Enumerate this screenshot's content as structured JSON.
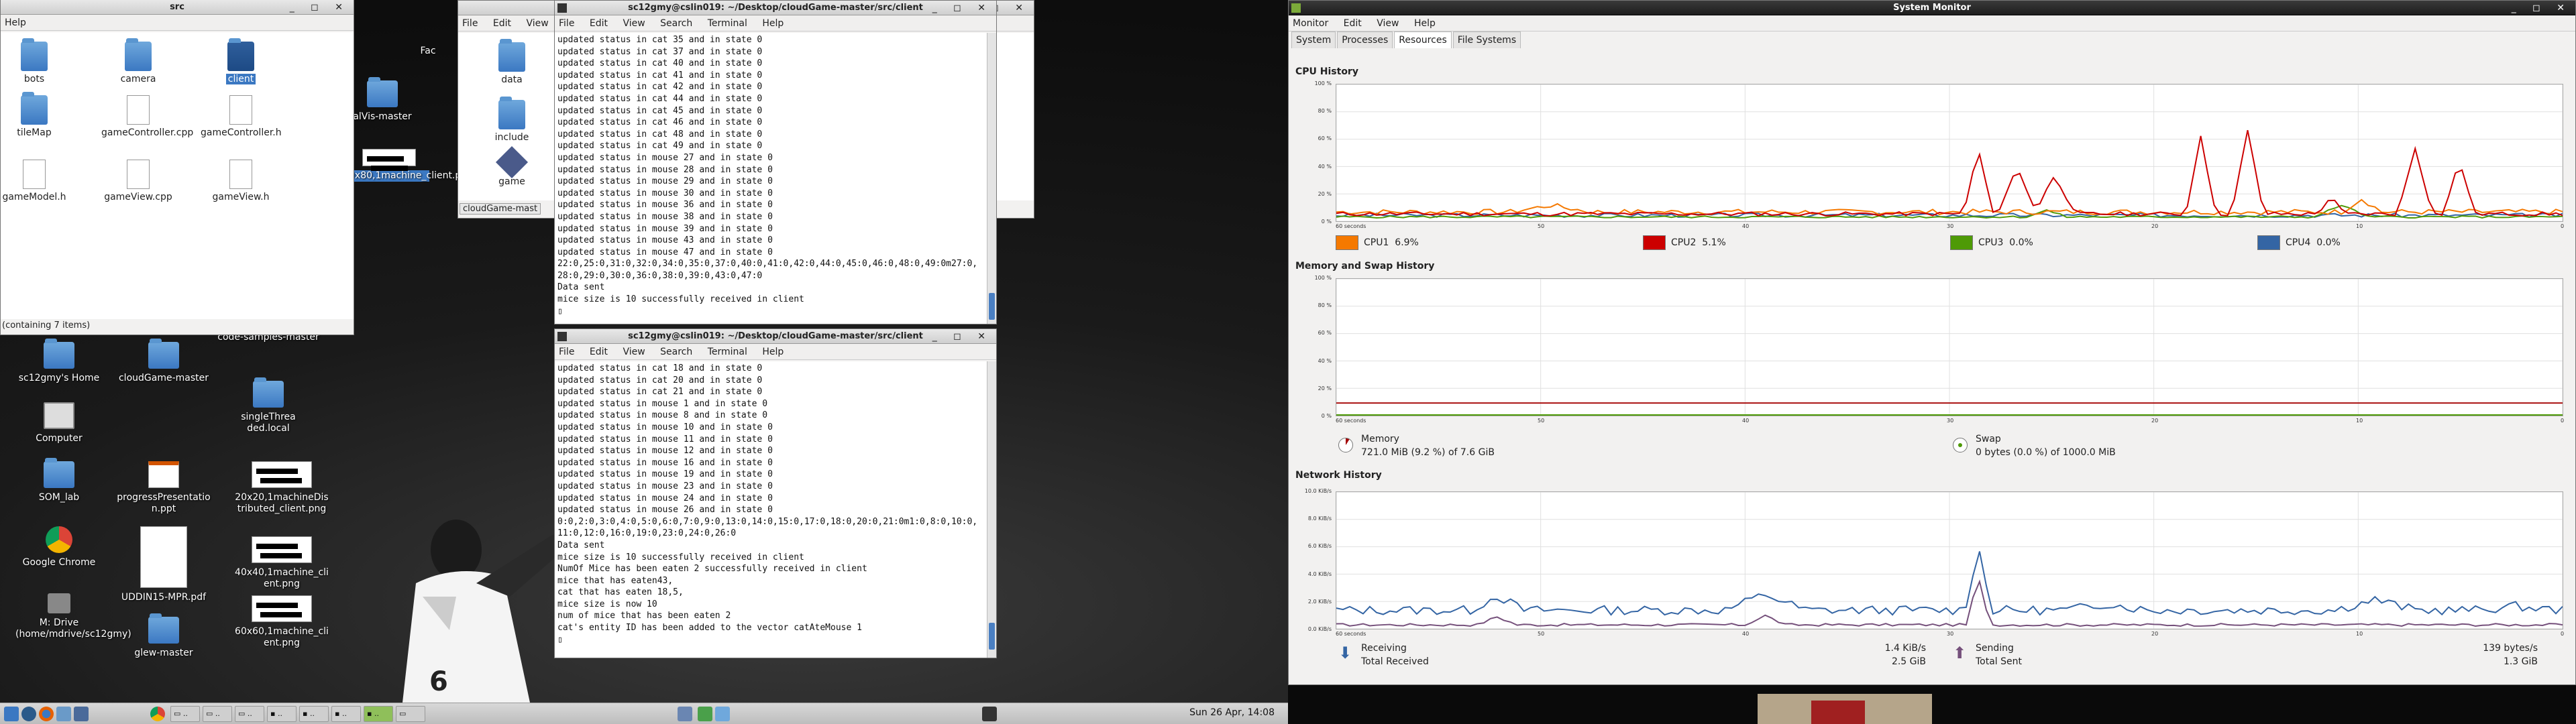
{
  "desktop_icons": [
    {
      "label": "sc12gmy's Home",
      "icon": "home-folder-icon"
    },
    {
      "label": "cloudGame-master",
      "icon": "folder-icon"
    },
    {
      "label": "code-samples-master",
      "icon": "folder-icon"
    },
    {
      "label": "Computer",
      "icon": "computer-icon"
    },
    {
      "label": "singleThreaded.local",
      "icon": "folder-icon"
    },
    {
      "label": "SOM_lab",
      "icon": "folder-icon"
    },
    {
      "label": "progressPresentation.ppt",
      "icon": "presentation-icon"
    },
    {
      "label": "20x20,1machineDistributed_client.png",
      "icon": "image-icon"
    },
    {
      "label": "Google Chrome",
      "icon": "chrome-icon"
    },
    {
      "label": "UDDIN15-MPR.pdf",
      "icon": "pdf-icon"
    },
    {
      "label": "40x40,1machine_client.png",
      "icon": "image-icon"
    },
    {
      "label": "M: Drive (home/mdrive/sc12gmy)",
      "icon": "drive-icon"
    },
    {
      "label": "60x60,1machine_client.png",
      "icon": "image-icon"
    },
    {
      "label": "glew-master",
      "icon": "folder-icon"
    },
    {
      "label": "alVis-master",
      "icon": "folder-icon"
    },
    {
      "label": "0x80,1machine_client.png",
      "icon": "image-icon"
    },
    {
      "label": "Fac",
      "icon": "folder-icon"
    }
  ],
  "file_manager": {
    "title": "src",
    "menu": "Help",
    "status": "(containing 7 items)",
    "items": [
      "bots",
      "camera",
      "client",
      "tileMap",
      "gameController.cpp",
      "gameController.h",
      "gameModel.h",
      "gameView.cpp",
      "gameView.h"
    ]
  },
  "file_manager2": {
    "menu": [
      "File",
      "Edit",
      "View"
    ],
    "items": [
      "data",
      "include",
      "game"
    ],
    "path": "cloudGame-mast"
  },
  "terminal1": {
    "title": "sc12gmy@cslin019: ~/Desktop/cloudGame-master/src/client",
    "menu": [
      "File",
      "Edit",
      "View",
      "Search",
      "Terminal",
      "Help"
    ],
    "lines": [
      "updated status in cat 35 and in state 0",
      "updated status in cat 37 and in state 0",
      "updated status in cat 40 and in state 0",
      "updated status in cat 41 and in state 0",
      "updated status in cat 42 and in state 0",
      "updated status in cat 44 and in state 0",
      "updated status in cat 45 and in state 0",
      "updated status in cat 46 and in state 0",
      "updated status in cat 48 and in state 0",
      "updated status in cat 49 and in state 0",
      "updated status in mouse 27 and in state 0",
      "updated status in mouse 28 and in state 0",
      "updated status in mouse 29 and in state 0",
      "updated status in mouse 30 and in state 0",
      "updated status in mouse 36 and in state 0",
      "updated status in mouse 38 and in state 0",
      "updated status in mouse 39 and in state 0",
      "updated status in mouse 43 and in state 0",
      "updated status in mouse 47 and in state 0",
      "22:0,25:0,31:0,32:0,34:0,35:0,37:0,40:0,41:0,42:0,44:0,45:0,46:0,48:0,49:0m27:0,",
      "28:0,29:0,30:0,36:0,38:0,39:0,43:0,47:0",
      "Data sent",
      "mice size is 10 successfully received in client",
      "▯"
    ]
  },
  "terminal2": {
    "title": "sc12gmy@cslin019: ~/Desktop/cloudGame-master/src/client",
    "menu": [
      "File",
      "Edit",
      "View",
      "Search",
      "Terminal",
      "Help"
    ],
    "lines": [
      "updated status in cat 18 and in state 0",
      "updated status in cat 20 and in state 0",
      "updated status in cat 21 and in state 0",
      "updated status in mouse 1 and in state 0",
      "updated status in mouse 8 and in state 0",
      "updated status in mouse 10 and in state 0",
      "updated status in mouse 11 and in state 0",
      "updated status in mouse 12 and in state 0",
      "updated status in mouse 16 and in state 0",
      "updated status in mouse 19 and in state 0",
      "updated status in mouse 23 and in state 0",
      "updated status in mouse 24 and in state 0",
      "updated status in mouse 26 and in state 0",
      "0:0,2:0,3:0,4:0,5:0,6:0,7:0,9:0,13:0,14:0,15:0,17:0,18:0,20:0,21:0m1:0,8:0,10:0,",
      "11:0,12:0,16:0,19:0,23:0,24:0,26:0",
      "Data sent",
      "mice size is 10 successfully received in client",
      "NumOf Mice has been eaten 2 successfully received in client",
      "mice that has eaten43,",
      "cat that has eaten 18,5,",
      "mice size is now 10",
      "num of mice that has been eaten 2",
      "cat's entity ID has been added to the vector catAteMouse 1",
      "▯"
    ]
  },
  "system_monitor": {
    "title": "System Monitor",
    "menu": [
      "Monitor",
      "Edit",
      "View",
      "Help"
    ],
    "tabs": [
      "System",
      "Processes",
      "Resources",
      "File Systems"
    ],
    "cpu_title": "CPU History",
    "mem_title": "Memory and Swap History",
    "net_title": "Network History",
    "x_labels": [
      "60 seconds",
      "50",
      "40",
      "30",
      "20",
      "10",
      "0"
    ],
    "cpu_y": [
      "100 %",
      "80 %",
      "60 %",
      "40 %",
      "20 %",
      "0 %"
    ],
    "mem_y": [
      "100 %",
      "80 %",
      "60 %",
      "40 %",
      "20 %",
      "0 %"
    ],
    "net_y": [
      "10.0 KiB/s",
      "8.0 KiB/s",
      "6.0 KiB/s",
      "4.0 KiB/s",
      "2.0 KiB/s",
      "0.0 KiB/s"
    ],
    "cpus": [
      {
        "label": "CPU1",
        "value": "6.9%",
        "color": "#f57900"
      },
      {
        "label": "CPU2",
        "value": "5.1%",
        "color": "#cc0000"
      },
      {
        "label": "CPU3",
        "value": "0.0%",
        "color": "#4e9a06"
      },
      {
        "label": "CPU4",
        "value": "0.0%",
        "color": "#3465a4"
      }
    ],
    "memory": {
      "label": "Memory",
      "value": "721.0 MiB (9.2 %) of 7.6 GiB"
    },
    "swap": {
      "label": "Swap",
      "value": "0 bytes (0.0 %) of 1000.0 MiB"
    },
    "network": {
      "receiving_label": "Receiving",
      "receiving": "1.4 KiB/s",
      "total_received_label": "Total Received",
      "total_received": "2.5 GiB",
      "sending_label": "Sending",
      "sending": "139 bytes/s",
      "total_sent_label": "Total Sent",
      "total_sent": "1.3 GiB"
    }
  },
  "taskbar": {
    "clock": "Sun 26 Apr, 14:08"
  }
}
